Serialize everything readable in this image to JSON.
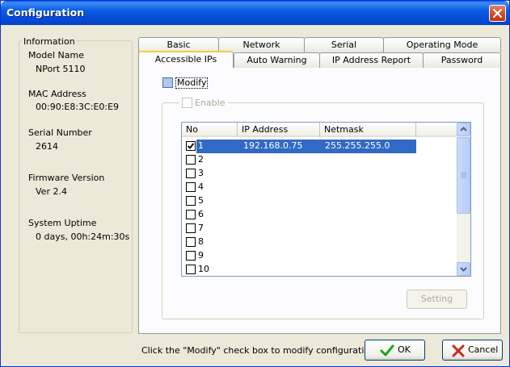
{
  "window": {
    "title": "Configuration"
  },
  "info": {
    "legend": "Information",
    "model_name_label": "Model Name",
    "model_name": "NPort 5110",
    "mac_label": "MAC Address",
    "mac": "00:90:E8:3C:E0:E9",
    "serial_label": "Serial Number",
    "serial": "2614",
    "firmware_label": "Firmware Version",
    "firmware": "Ver 2.4",
    "uptime_label": "System Uptime",
    "uptime": "0 days, 00h:24m:30s"
  },
  "tabs": {
    "row1": [
      "Basic",
      "Network",
      "Serial",
      "Operating Mode"
    ],
    "row2": [
      "Accessible IPs",
      "Auto Warning",
      "IP Address Report",
      "Password"
    ],
    "active": "Accessible IPs"
  },
  "panel": {
    "modify_label": "Modify",
    "enable_label": "Enable",
    "columns": [
      "No",
      "IP Address",
      "Netmask"
    ],
    "rows": [
      {
        "no": "1",
        "ip": "192.168.0.75",
        "mask": "255.255.255.0",
        "checked": true,
        "selected": true
      },
      {
        "no": "2",
        "ip": "",
        "mask": "",
        "checked": false
      },
      {
        "no": "3",
        "ip": "",
        "mask": "",
        "checked": false
      },
      {
        "no": "4",
        "ip": "",
        "mask": "",
        "checked": false
      },
      {
        "no": "5",
        "ip": "",
        "mask": "",
        "checked": false
      },
      {
        "no": "6",
        "ip": "",
        "mask": "",
        "checked": false
      },
      {
        "no": "7",
        "ip": "",
        "mask": "",
        "checked": false
      },
      {
        "no": "8",
        "ip": "",
        "mask": "",
        "checked": false
      },
      {
        "no": "9",
        "ip": "",
        "mask": "",
        "checked": false
      },
      {
        "no": "10",
        "ip": "",
        "mask": "",
        "checked": false
      }
    ],
    "setting_label": "Setting"
  },
  "footer": {
    "hint": "Click the \"Modify\" check box to modify configuration",
    "ok_label": "OK",
    "cancel_label": "Cancel"
  },
  "colors": {
    "title_bar": "#0545d1",
    "selection": "#316ac5",
    "active_tab_accent": "#ffc83c"
  }
}
